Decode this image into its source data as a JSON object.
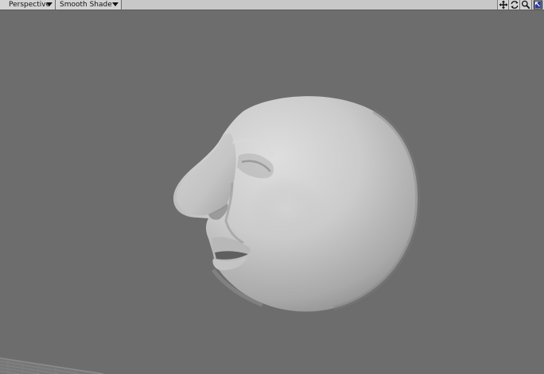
{
  "viewport": {
    "view_mode": "Perspective",
    "shading_mode": "Smooth Shade"
  },
  "toolbar": {
    "icons": [
      "move-view-icon",
      "rotate-view-icon",
      "zoom-view-icon",
      "maximize-viewport-icon"
    ]
  },
  "colors": {
    "background": "#6d6d6d",
    "toolbar": "#c8c8c8",
    "model": "#c8c8c8"
  }
}
